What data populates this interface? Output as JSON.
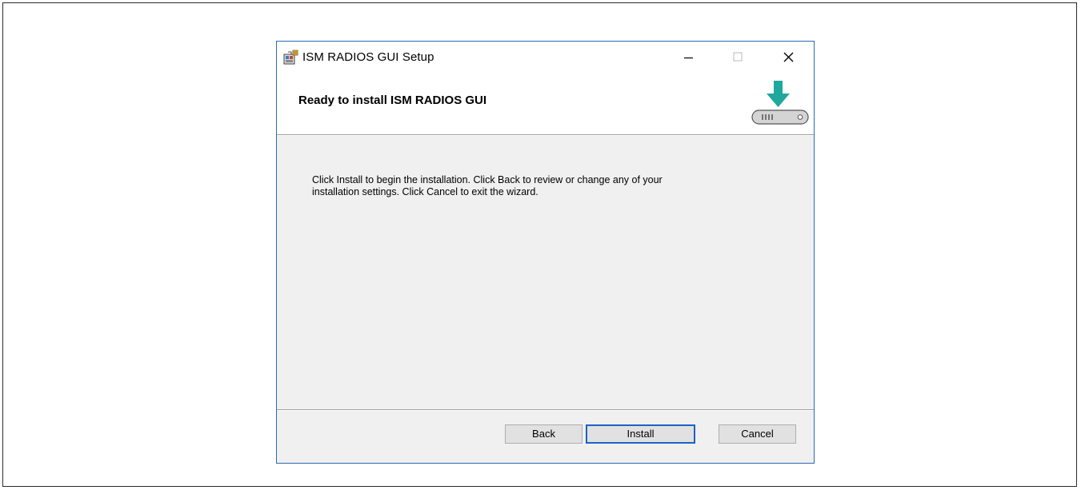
{
  "window": {
    "title": "ISM RADIOS GUI Setup",
    "controls": {
      "minimize_glyph": "—",
      "maximize_glyph": "□",
      "close_glyph": "✕"
    }
  },
  "header": {
    "title": "Ready to install ISM RADIOS GUI",
    "icon": "download-to-drive-icon"
  },
  "body": {
    "line1": "Click Install to begin the installation. Click Back to review or change any of your",
    "line2": "installation settings. Click Cancel to exit the wizard."
  },
  "buttons": {
    "back": "Back",
    "install": "Install",
    "cancel": "Cancel"
  },
  "colors": {
    "window_border": "#2a6ab4",
    "dialog_bg": "#f0f0f0",
    "header_bg": "#ffffff",
    "arrow": "#1fa89c",
    "default_button_border": "#1a63c4"
  }
}
